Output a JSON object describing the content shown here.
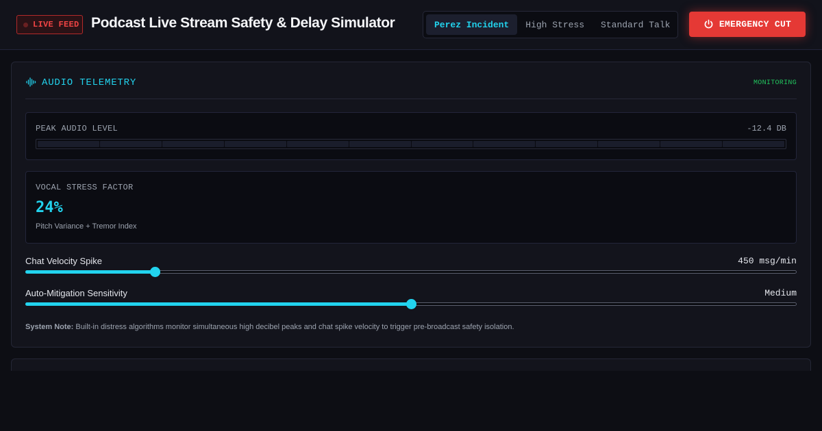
{
  "header": {
    "live_badge": "LIVE FEED",
    "title": "Podcast Live Stream Safety & Delay Simulator",
    "tabs": [
      {
        "label": "Perez Incident",
        "active": true
      },
      {
        "label": "High Stress",
        "active": false
      },
      {
        "label": "Standard Talk",
        "active": false
      }
    ],
    "emergency_label": "EMERGENCY CUT",
    "emergency_icon": "power-icon"
  },
  "telemetry": {
    "title": "AUDIO TELEMETRY",
    "icon": "waveform-icon",
    "status": "MONITORING",
    "peak": {
      "label": "PEAK AUDIO LEVEL",
      "value": "-12.4 DB",
      "segments_total": 12,
      "segments_lit": 0
    },
    "stress": {
      "label": "VOCAL STRESS FACTOR",
      "value": "24%",
      "subtitle": "Pitch Variance + Tremor Index"
    },
    "sliders": [
      {
        "label": "Chat Velocity Spike",
        "value": "450 msg/min",
        "level": 0.168
      },
      {
        "label": "Auto-Mitigation Sensitivity",
        "value": "Medium",
        "level": 0.5
      }
    ],
    "note": {
      "prefix": "System Note:",
      "text": " Built-in distress algorithms monitor simultaneous high decibel peaks and chat spike velocity to trigger pre-broadcast safety isolation."
    }
  },
  "colors": {
    "accent": "#22d3ee",
    "danger": "#e53935",
    "ok": "#22c55e",
    "background": "#0d0e14"
  }
}
